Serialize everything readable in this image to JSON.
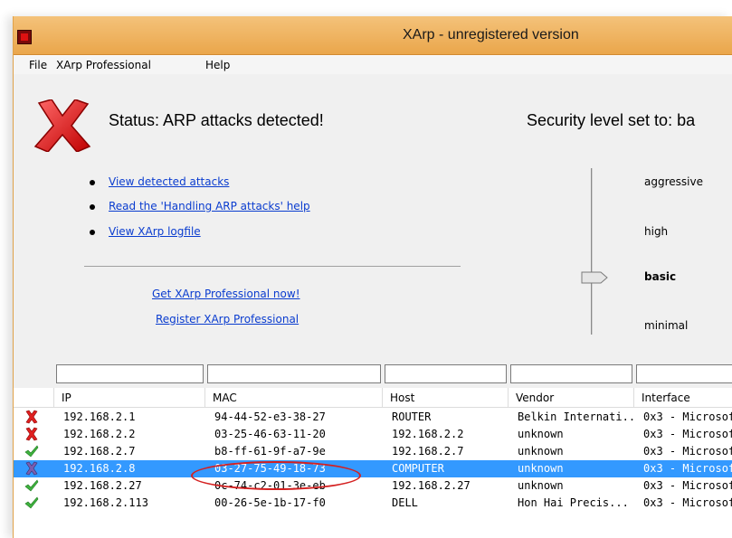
{
  "window": {
    "title": "XArp - unregistered version"
  },
  "menu": {
    "items": [
      "File",
      "XArp Professional",
      "Help"
    ]
  },
  "status": {
    "icon": "red-x-icon",
    "text": "Status:  ARP attacks detected!",
    "security_text": "Security level set to:  ba"
  },
  "links": [
    {
      "label": "View detected attacks"
    },
    {
      "label": "Read the 'Handling ARP attacks' help"
    },
    {
      "label": "View XArp logfile"
    }
  ],
  "promo": {
    "get_label": "Get XArp Professional now!",
    "register_label": "Register XArp Professional"
  },
  "security_levels": {
    "items": [
      "aggressive",
      "high",
      "basic",
      "minimal"
    ],
    "selected": "basic"
  },
  "table": {
    "columns": [
      "IP",
      "MAC",
      "Host",
      "Vendor",
      "Interface"
    ],
    "rows": [
      {
        "status": "red-x-icon",
        "ip": "192.168.2.1",
        "mac": "94-44-52-e3-38-27",
        "host": "ROUTER",
        "vendor": "Belkin Internati...",
        "interface": "0x3 - Microsof"
      },
      {
        "status": "red-x-icon",
        "ip": "192.168.2.2",
        "mac": "03-25-46-63-11-20",
        "host": "192.168.2.2",
        "vendor": "unknown",
        "interface": "0x3 - Microsof"
      },
      {
        "status": "green-check-icon",
        "ip": "192.168.2.7",
        "mac": "b8-ff-61-9f-a7-9e",
        "host": "192.168.2.7",
        "vendor": "unknown",
        "interface": "0x3 - Microsof"
      },
      {
        "status": "purple-x-icon",
        "ip": "192.168.2.8",
        "mac": "03-27-75-49-18-73",
        "host": "COMPUTER",
        "vendor": "unknown",
        "interface": "0x3 - Microsof",
        "selected": true
      },
      {
        "status": "green-check-icon",
        "ip": "192.168.2.27",
        "mac": "0c-74-c2-01-3e-eb",
        "host": "192.168.2.27",
        "vendor": "unknown",
        "interface": "0x3 - Microsof"
      },
      {
        "status": "green-check-icon",
        "ip": "192.168.2.113",
        "mac": "00-26-5e-1b-17-f0",
        "host": "DELL",
        "vendor": "Hon Hai Precis...",
        "interface": "0x3 - Microsof"
      }
    ]
  },
  "colors": {
    "title_bar": "#f0b060",
    "link": "#0a3ccf",
    "selected_row": "#3399ff",
    "annotation": "#d42020"
  }
}
